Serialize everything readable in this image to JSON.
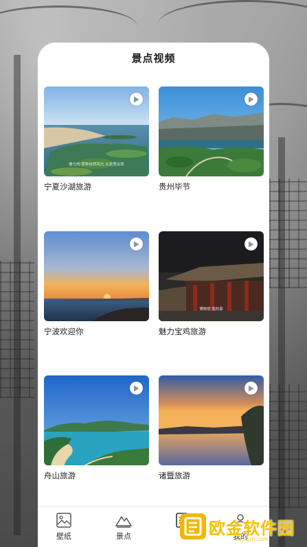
{
  "header": {
    "title": "景点视频"
  },
  "videos": [
    {
      "caption": "宁夏沙湖旅游",
      "overlay_text": "看它的 那种自然风光 从这里出发"
    },
    {
      "caption": "贵州毕节"
    },
    {
      "caption": "宁波欢迎你"
    },
    {
      "caption": "魅力宝鸡旅游",
      "overlay_text": "博物馆 我的家"
    },
    {
      "caption": "舟山旅游"
    },
    {
      "caption": "诸暨旅游"
    }
  ],
  "tabbar": {
    "items": [
      {
        "label": "壁纸",
        "icon": "image-icon"
      },
      {
        "label": "景点",
        "icon": "mountain-icon"
      },
      {
        "label": "",
        "icon": "document-icon"
      },
      {
        "label": "我的",
        "icon": "user-icon"
      }
    ]
  },
  "watermark": {
    "text": "欧金软件园",
    "url": "ouyujin.com"
  },
  "colors": {
    "accent": "#f5c200",
    "card_bg": "#ffffff",
    "text": "#222222"
  }
}
